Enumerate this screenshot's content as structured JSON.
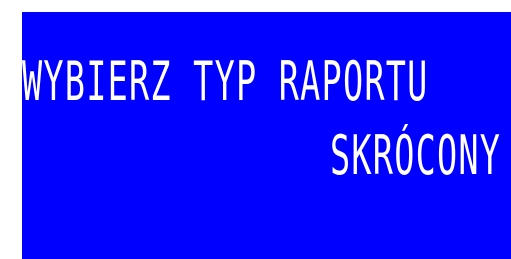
{
  "display": {
    "line1": "WYBIERZ TYP RAPORTU",
    "line2": "SKRÓCONY",
    "background_color": "#0000ff",
    "text_color": "#ffffff"
  }
}
